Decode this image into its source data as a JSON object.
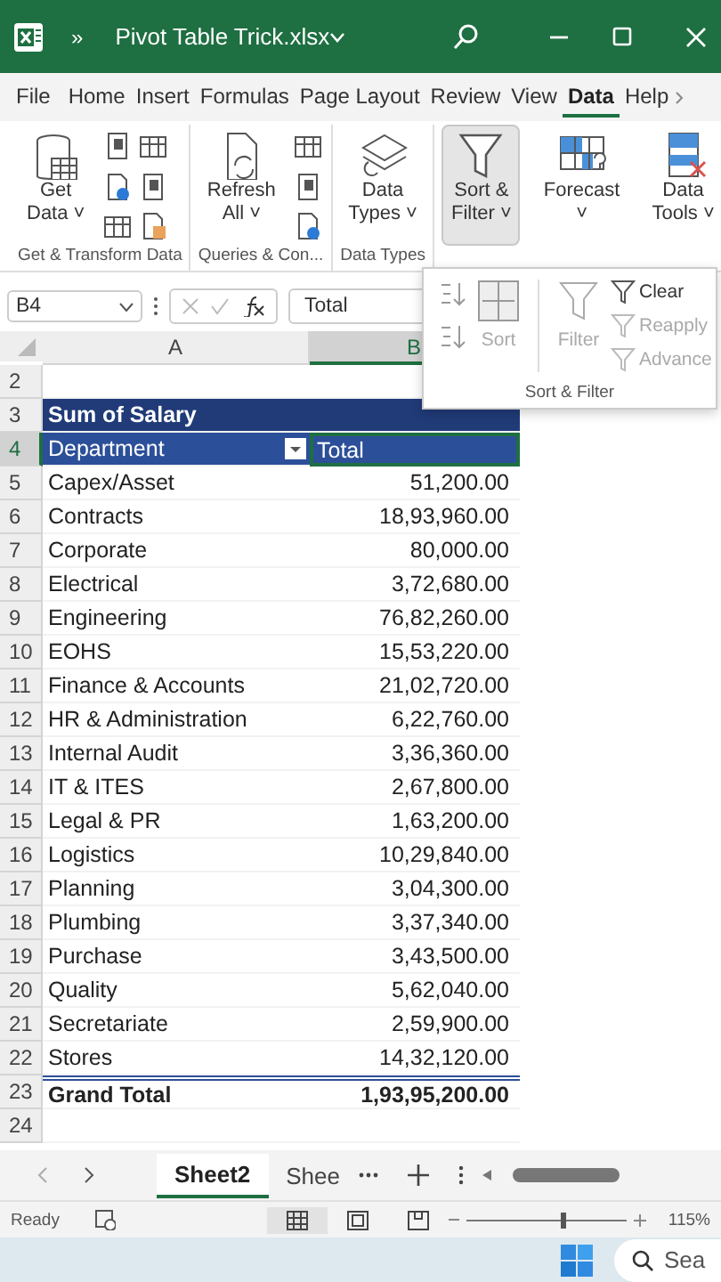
{
  "title_bar": {
    "overflow": "»",
    "file_name": "Pivot Table Trick.xlsx"
  },
  "tabs": [
    {
      "label": "File",
      "selected": false
    },
    {
      "label": "Home",
      "selected": false
    },
    {
      "label": "Insert",
      "selected": false
    },
    {
      "label": "Formulas",
      "selected": false
    },
    {
      "label": "Page Layout",
      "selected": false
    },
    {
      "label": "Review",
      "selected": false
    },
    {
      "label": "View",
      "selected": false
    },
    {
      "label": "Data",
      "selected": true
    },
    {
      "label": "Help",
      "selected": false
    }
  ],
  "ribbon_groups": [
    {
      "kind": "getdata",
      "button": [
        "Get",
        "Data ˅"
      ],
      "label": "Get & Transform Data",
      "pressed": false
    },
    {
      "kind": "refresh",
      "button": [
        "Refresh",
        "All ˅"
      ],
      "label": "Queries & Con...",
      "pressed": false
    },
    {
      "kind": "datatypes",
      "button": [
        "Data",
        "Types ˅"
      ],
      "label": "Data Types",
      "pressed": false
    },
    {
      "kind": "sortfilter",
      "button": [
        "Sort &",
        "Filter ˅"
      ],
      "pressed": true
    },
    {
      "kind": "forecast",
      "button": [
        "Forecast",
        "˅"
      ],
      "pressed": false
    },
    {
      "kind": "datatools",
      "button": [
        "Data",
        "Tools ˅"
      ],
      "pressed": false
    }
  ],
  "sort_filter_menu": {
    "sort": {
      "label": "Sort",
      "disabled": true
    },
    "filter": {
      "label": "Filter",
      "disabled": true
    },
    "actions": [
      {
        "label": "Clear",
        "disabled": false
      },
      {
        "label": "Reapply",
        "disabled": true
      },
      {
        "label": "Advance",
        "disabled": true
      }
    ],
    "group_label": "Sort & Filter"
  },
  "formula_bar": {
    "name_box": "B4",
    "formula": "Total"
  },
  "columns": [
    {
      "label": "A",
      "selected": false
    },
    {
      "label": "B",
      "selected": true
    }
  ],
  "rows": [
    {
      "number": "2",
      "kind": "blank"
    },
    {
      "number": "3",
      "kind": "title",
      "a": "Sum of Salary"
    },
    {
      "number": "4",
      "kind": "header",
      "a": "Department",
      "b": "Total",
      "b_selected": true
    },
    {
      "number": "5",
      "kind": "data",
      "a": "Capex/Asset",
      "b": "51,200.00"
    },
    {
      "number": "6",
      "kind": "data",
      "a": "Contracts",
      "b": "18,93,960.00"
    },
    {
      "number": "7",
      "kind": "data",
      "a": "Corporate",
      "b": "80,000.00"
    },
    {
      "number": "8",
      "kind": "data",
      "a": "Electrical",
      "b": "3,72,680.00"
    },
    {
      "number": "9",
      "kind": "data",
      "a": "Engineering",
      "b": "76,82,260.00"
    },
    {
      "number": "10",
      "kind": "data",
      "a": "EOHS",
      "b": "15,53,220.00"
    },
    {
      "number": "11",
      "kind": "data",
      "a": "Finance & Accounts",
      "b": "21,02,720.00"
    },
    {
      "number": "12",
      "kind": "data",
      "a": "HR & Administration",
      "b": "6,22,760.00"
    },
    {
      "number": "13",
      "kind": "data",
      "a": "Internal Audit",
      "b": "3,36,360.00"
    },
    {
      "number": "14",
      "kind": "data",
      "a": "IT & ITES",
      "b": "2,67,800.00"
    },
    {
      "number": "15",
      "kind": "data",
      "a": "Legal & PR",
      "b": "1,63,200.00"
    },
    {
      "number": "16",
      "kind": "data",
      "a": "Logistics",
      "b": "10,29,840.00"
    },
    {
      "number": "17",
      "kind": "data",
      "a": "Planning",
      "b": "3,04,300.00"
    },
    {
      "number": "18",
      "kind": "data",
      "a": "Plumbing",
      "b": "3,37,340.00"
    },
    {
      "number": "19",
      "kind": "data",
      "a": "Purchase",
      "b": "3,43,500.00"
    },
    {
      "number": "20",
      "kind": "data",
      "a": "Quality",
      "b": "5,62,040.00"
    },
    {
      "number": "21",
      "kind": "data",
      "a": "Secretariate",
      "b": "2,59,900.00"
    },
    {
      "number": "22",
      "kind": "data",
      "a": "Stores",
      "b": "14,32,120.00"
    },
    {
      "number": "23",
      "kind": "total",
      "a": "Grand Total",
      "b": "1,93,95,200.00"
    },
    {
      "number": "24",
      "kind": "blank"
    }
  ],
  "sheet_tabs": [
    {
      "label": "Sheet2",
      "selected": true
    },
    {
      "label": "Shee",
      "selected": false
    }
  ],
  "status_bar": {
    "status": "Ready",
    "zoom": "115%",
    "level": 0.6
  },
  "taskbar": {
    "search_placeholder": "Sea"
  }
}
